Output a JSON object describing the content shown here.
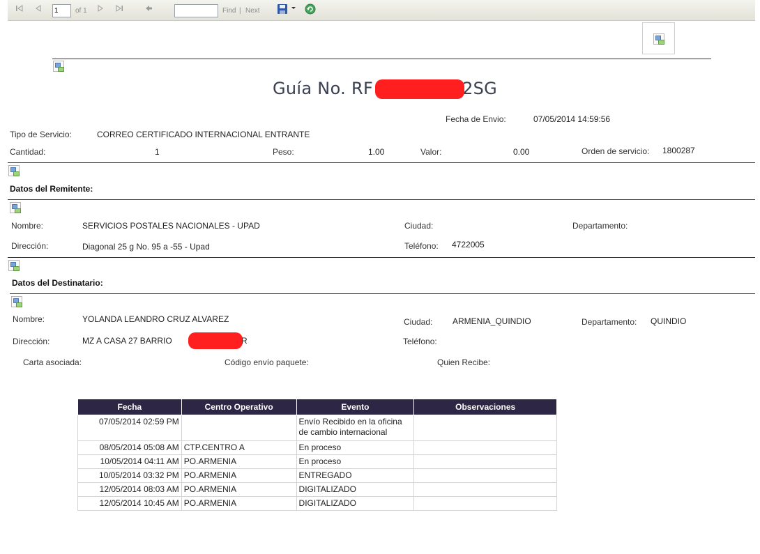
{
  "toolbar": {
    "page_current": "1",
    "page_of": "of 1",
    "find_value": "",
    "find_label": "Find",
    "separator": "|",
    "next_label": "Next",
    "icons": [
      "first-page-icon",
      "previous-page-icon",
      "next-page-icon",
      "last-page-icon",
      "back-icon",
      "export-save-icon",
      "dropdown-arrow-icon",
      "refresh-icon"
    ]
  },
  "report": {
    "title_prefix": "Guía No. RF",
    "title_suffix": "2SG",
    "fecha_envio_label": "Fecha de Envio:",
    "fecha_envio_value": "07/05/2014 14:59:56",
    "tipo_servicio_label": "Tipo de Servicio:",
    "tipo_servicio_value": "CORREO CERTIFICADO INTERNACIONAL ENTRANTE",
    "cantidad_label": "Cantidad:",
    "cantidad_value": "1",
    "peso_label": "Peso:",
    "peso_value": "1.00",
    "valor_label": "Valor:",
    "valor_value": "0.00",
    "orden_label": "Orden de servicio:",
    "orden_value": "1800287"
  },
  "remitente": {
    "title": "Datos del Remitente:",
    "nombre_label": "Nombre:",
    "nombre_value": "SERVICIOS POSTALES NACIONALES  - UPAD",
    "ciudad_label": "Ciudad:",
    "ciudad_value": "",
    "departamento_label": "Departamento:",
    "departamento_value": "",
    "direccion_label": "Dirección:",
    "direccion_value": "Diagonal 25 g No. 95 a -55 - Upad",
    "telefono_label": "Teléfono:",
    "telefono_value": "4722005"
  },
  "destinatario": {
    "title": "Datos del Destinatario:",
    "nombre_label": "Nombre:",
    "nombre_value": "YOLANDA LEANDRO CRUZ ALVAREZ",
    "ciudad_label": "Ciudad:",
    "ciudad_value": "ARMENIA_QUINDIO",
    "departamento_label": "Departamento:",
    "departamento_value": "QUINDIO",
    "direccion_label": "Dirección:",
    "direccion_value": "MZ A  CASA 27 BARRIO",
    "direccion_suffix": "R",
    "telefono_label": "Teléfono:",
    "telefono_value": ""
  },
  "extra": {
    "carta_label": "Carta asociada:",
    "codigo_label": "Código envío paquete:",
    "quien_label": "Quien Recibe:"
  },
  "events": {
    "headers": [
      "Fecha",
      "Centro Operativo",
      "Evento",
      "Observaciones"
    ],
    "rows": [
      {
        "fecha": "07/05/2014 02:59 PM",
        "centro": "",
        "evento": " Envío Recibido en la oficina de cambio internacional",
        "obs": ""
      },
      {
        "fecha": "08/05/2014 05:08 AM",
        "centro": "CTP.CENTRO A",
        "evento": "En proceso",
        "obs": ""
      },
      {
        "fecha": "10/05/2014 04:11 AM",
        "centro": "PO.ARMENIA",
        "evento": "En proceso",
        "obs": ""
      },
      {
        "fecha": "10/05/2014 03:32 PM",
        "centro": "PO.ARMENIA",
        "evento": "ENTREGADO",
        "obs": ""
      },
      {
        "fecha": "12/05/2014 08:03 AM",
        "centro": "PO.ARMENIA",
        "evento": "DIGITALIZADO",
        "obs": ""
      },
      {
        "fecha": "12/05/2014 10:45 AM",
        "centro": "PO.ARMENIA",
        "evento": "DIGITALIZADO",
        "obs": ""
      }
    ]
  },
  "colors": {
    "table_header_bg": "#2e2645",
    "redaction": "#ff1f1f",
    "title_color": "#3a3f52"
  }
}
